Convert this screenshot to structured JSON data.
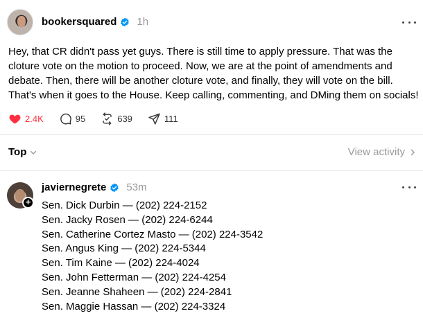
{
  "post": {
    "username": "bookersquared",
    "time": "1h",
    "text": "Hey, that CR didn't pass yet guys. There is still time to apply pressure. That was the cloture vote on the motion to proceed. Now, we are at the point of amendments and debate. Then, there will be another cloture vote, and finally, they will vote on the bill. That's when it goes to the House. Keep calling, commenting, and DMing them on socials!",
    "likes": "2.4K",
    "comments": "95",
    "reposts": "639",
    "shares": "111",
    "like_color": "#ff3040",
    "verified_color": "#0095f6"
  },
  "sort": {
    "label": "Top",
    "view_activity": "View activity"
  },
  "reply": {
    "username": "javiernegrete",
    "time": "53m",
    "lines": [
      "Sen. Dick Durbin — (202) 224-2152",
      "Sen. Jacky Rosen — (202) 224-6244",
      "Sen. Catherine Cortez Masto — (202) 224-3542",
      "Sen. Angus King — (202) 224-5344",
      "Sen. Tim Kaine — (202) 224-4024",
      "Sen. John Fetterman — (202) 224-4254",
      "Sen. Jeanne Shaheen — (202) 224-2841",
      "Sen. Maggie Hassan — (202) 224-3324"
    ]
  }
}
